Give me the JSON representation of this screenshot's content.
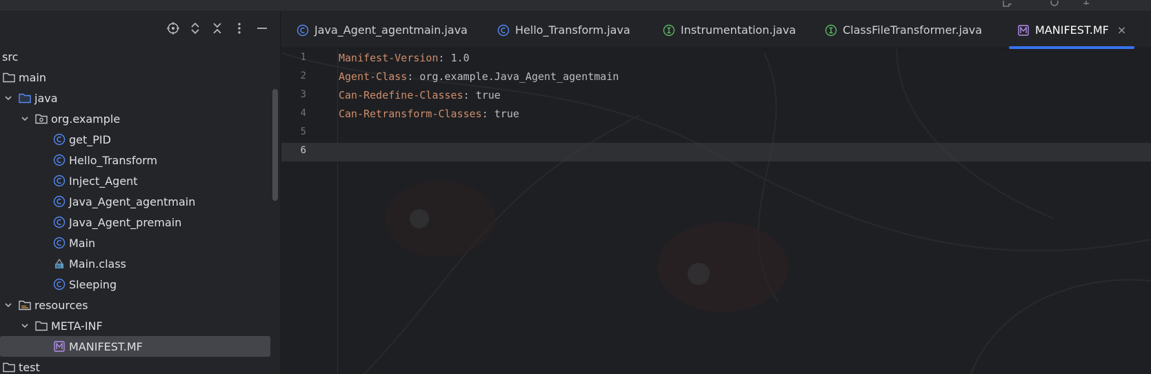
{
  "project_panel": {
    "toolbar": {
      "locate_icon": "crosshair-icon",
      "expand_icon": "expand-all-icon",
      "collapse_icon": "collapse-all-icon",
      "options_icon": "more-vertical-icon",
      "hide_icon": "minimize-icon"
    },
    "tree": [
      {
        "label": "src",
        "depth": 0,
        "icon": "none",
        "chevron": false
      },
      {
        "label": "main",
        "depth": 0,
        "icon": "folder",
        "chevron": false
      },
      {
        "label": "java",
        "depth": 1,
        "icon": "source-folder",
        "chevron": true
      },
      {
        "label": "org.example",
        "depth": 2,
        "icon": "package",
        "chevron": true
      },
      {
        "label": "get_PID",
        "depth": 3,
        "icon": "class",
        "chevron": false
      },
      {
        "label": "Hello_Transform",
        "depth": 3,
        "icon": "class",
        "chevron": false
      },
      {
        "label": "Inject_Agent",
        "depth": 3,
        "icon": "class",
        "chevron": false
      },
      {
        "label": "Java_Agent_agentmain",
        "depth": 3,
        "icon": "class",
        "chevron": false
      },
      {
        "label": "Java_Agent_premain",
        "depth": 3,
        "icon": "class",
        "chevron": false
      },
      {
        "label": "Main",
        "depth": 3,
        "icon": "class",
        "chevron": false
      },
      {
        "label": "Main.class",
        "depth": 3,
        "icon": "class-file",
        "chevron": false
      },
      {
        "label": "Sleeping",
        "depth": 3,
        "icon": "class",
        "chevron": false
      },
      {
        "label": "resources",
        "depth": 1,
        "icon": "resources-folder",
        "chevron": true
      },
      {
        "label": "META-INF",
        "depth": 2,
        "icon": "folder",
        "chevron": true
      },
      {
        "label": "MANIFEST.MF",
        "depth": 3,
        "icon": "manifest",
        "chevron": false,
        "selected": true
      },
      {
        "label": "test",
        "depth": 0,
        "icon": "folder",
        "chevron": false
      }
    ]
  },
  "editor": {
    "tabs": [
      {
        "label": "Java_Agent_agentmain.java",
        "icon": "class"
      },
      {
        "label": "Hello_Transform.java",
        "icon": "class"
      },
      {
        "label": "Instrumentation.java",
        "icon": "interface"
      },
      {
        "label": "ClassFileTransformer.java",
        "icon": "interface"
      },
      {
        "label": "MANIFEST.MF",
        "icon": "manifest",
        "active": true,
        "close": "×"
      }
    ],
    "lines": [
      {
        "n": "1",
        "key": "Manifest-Version",
        "sep": ": ",
        "value": "1.0"
      },
      {
        "n": "2",
        "key": "Agent-Class",
        "sep": ": ",
        "value": "org.example.Java_Agent_agentmain"
      },
      {
        "n": "3",
        "key": "Can-Redefine-Classes",
        "sep": ": ",
        "value": "true"
      },
      {
        "n": "4",
        "key": "Can-Retransform-Classes",
        "sep": ": ",
        "value": "true"
      },
      {
        "n": "5",
        "key": "",
        "sep": "",
        "value": ""
      },
      {
        "n": "6",
        "key": "",
        "sep": "",
        "value": "",
        "current": true
      }
    ]
  },
  "colors": {
    "class_icon": "#548af7",
    "interface_icon": "#5fb865",
    "manifest_icon": "#b48ef0",
    "key": "#cf8e6d",
    "value": "#bcbec4",
    "accent": "#3574f0"
  }
}
